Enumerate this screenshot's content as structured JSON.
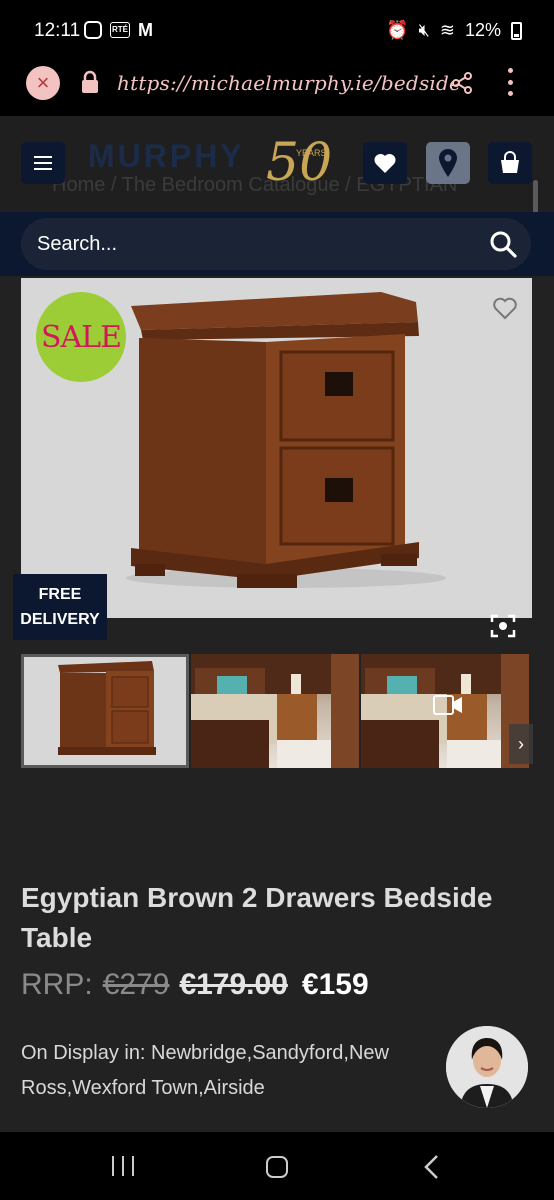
{
  "status": {
    "time": "12:11",
    "battery": "12%"
  },
  "browser": {
    "url": "https://michaelmurphy.ie/bedside"
  },
  "header": {
    "logo_text": "MURPHY",
    "logo_years": "50",
    "logo_years_label": "YEARS",
    "breadcrumb": "Home  /  The Bedroom Catalogue  /  EGYPTIAN"
  },
  "search": {
    "placeholder": "Search..."
  },
  "product": {
    "sale_badge": "SALE",
    "delivery_badge_line1": "FREE",
    "delivery_badge_line2": "DELIVERY",
    "title": "Egyptian Brown 2 Drawers Bedside Table",
    "rrp_label": "RRP:",
    "rrp_price": "€279",
    "was_price": "€179.00",
    "now_price": "€159",
    "display_info": "On Display in: Newbridge,Sandyford,New Ross,Wexford Town,Airside"
  },
  "colors": {
    "navy": "#0c1830",
    "accent_pink": "#f3c3c1",
    "sale_green": "#9ccd37",
    "sale_text": "#d1185b",
    "background": "#222222"
  },
  "icons": [
    "close-icon",
    "lock-icon",
    "share-icon",
    "more-icon",
    "menu-icon",
    "heart-icon",
    "location-pin-icon",
    "shopping-bag-icon",
    "search-icon",
    "wishlist-heart-icon",
    "fullscreen-icon",
    "video-icon",
    "chevron-right-icon"
  ]
}
